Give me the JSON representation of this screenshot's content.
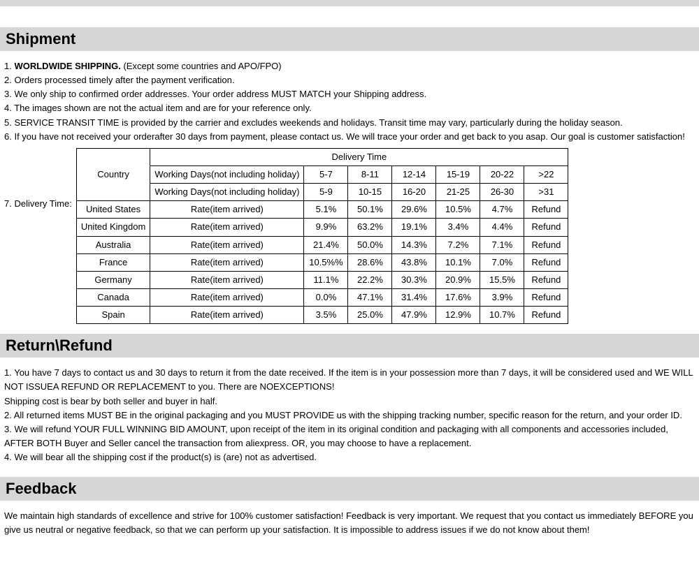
{
  "sections": {
    "shipment": {
      "heading": "Shipment",
      "line1_prefix": "1. ",
      "line1_bold": "WORLDWIDE SHIPPING.",
      "line1_suffix": " (Except some countries and APO/FPO)",
      "line2": "2. Orders processed timely after the payment verification.",
      "line3": "3. We only ship to confirmed order addresses. Your order address MUST MATCH your Shipping address.",
      "line4": "4. The images shown are not the actual item and are for your reference only.",
      "line5": "5. SERVICE TRANSIT TIME is provided by the carrier and excludes weekends and holidays. Transit time may vary, particularly during the holiday season.",
      "line6": "6. If you have not received your orderafter 30 days from payment, please contact us. We will trace your order and get back to   you asap. Our goal is customer satisfaction!",
      "line7_label": "7. Delivery Time:"
    },
    "return": {
      "heading": "Return\\Refund",
      "p1": "1. You have 7 days to contact us and 30 days to return it from the date received. If the item is in your possession more than 7 days, it will be considered used and WE WILL NOT ISSUEA REFUND OR REPLACEMENT to you. There are NOEXCEPTIONS!",
      "p1b": "Shipping cost is bear by both seller and buyer in half.",
      "p2": "2. All returned items MUST BE in the original packaging and you MUST PROVIDE us with the shipping tracking number, specific reason for the return, and your order ID.",
      "p3": "3. We will refund YOUR FULL WINNING BID AMOUNT, upon receipt of the item in its original condition and packaging with all components and accessories included, AFTER BOTH Buyer and Seller cancel the transaction from aliexpress. OR, you may choose to have a replacement.",
      "p4": "4. We will bear all the shipping cost if the product(s) is (are) not as advertised."
    },
    "feedback": {
      "heading": "Feedback",
      "p1": "We maintain high standards of excellence and strive for 100% customer satisfaction! Feedback is very important. We request that you contact us immediately BEFORE you give us neutral or negative feedback, so that we can perform up your satisfaction. It is impossible to address issues if we do not know about them!"
    }
  },
  "delivery_table": {
    "country_header": "Country",
    "delivery_time_header": "Delivery Time",
    "wd_row1_label": "Working Days(not including holiday)",
    "wd_row1_cols": [
      "5-7",
      "8-11",
      "12-14",
      "15-19",
      "20-22",
      ">22"
    ],
    "wd_row2_label": "Working Days(not including holiday)",
    "wd_row2_cols": [
      "5-9",
      "10-15",
      "16-20",
      "21-25",
      "26-30",
      ">31"
    ],
    "rate_label": "Rate(item arrived)",
    "rows": [
      {
        "country": "United States",
        "vals": [
          "5.1%",
          "50.1%",
          "29.6%",
          "10.5%",
          "4.7%",
          "Refund"
        ]
      },
      {
        "country": "United Kingdom",
        "vals": [
          "9.9%",
          "63.2%",
          "19.1%",
          "3.4%",
          "4.4%",
          "Refund"
        ]
      },
      {
        "country": "Australia",
        "vals": [
          "21.4%",
          "50.0%",
          "14.3%",
          "7.2%",
          "7.1%",
          "Refund"
        ]
      },
      {
        "country": "France",
        "vals": [
          "10.5%%",
          "28.6%",
          "43.8%",
          "10.1%",
          "7.0%",
          "Refund"
        ]
      },
      {
        "country": "Germany",
        "vals": [
          "11.1%",
          "22.2%",
          "30.3%",
          "20.9%",
          "15.5%",
          "Refund"
        ]
      },
      {
        "country": "Canada",
        "vals": [
          "0.0%",
          "47.1%",
          "31.4%",
          "17.6%",
          "3.9%",
          "Refund"
        ]
      },
      {
        "country": "Spain",
        "vals": [
          "3.5%",
          "25.0%",
          "47.9%",
          "12.9%",
          "10.7%",
          "Refund"
        ]
      }
    ]
  }
}
